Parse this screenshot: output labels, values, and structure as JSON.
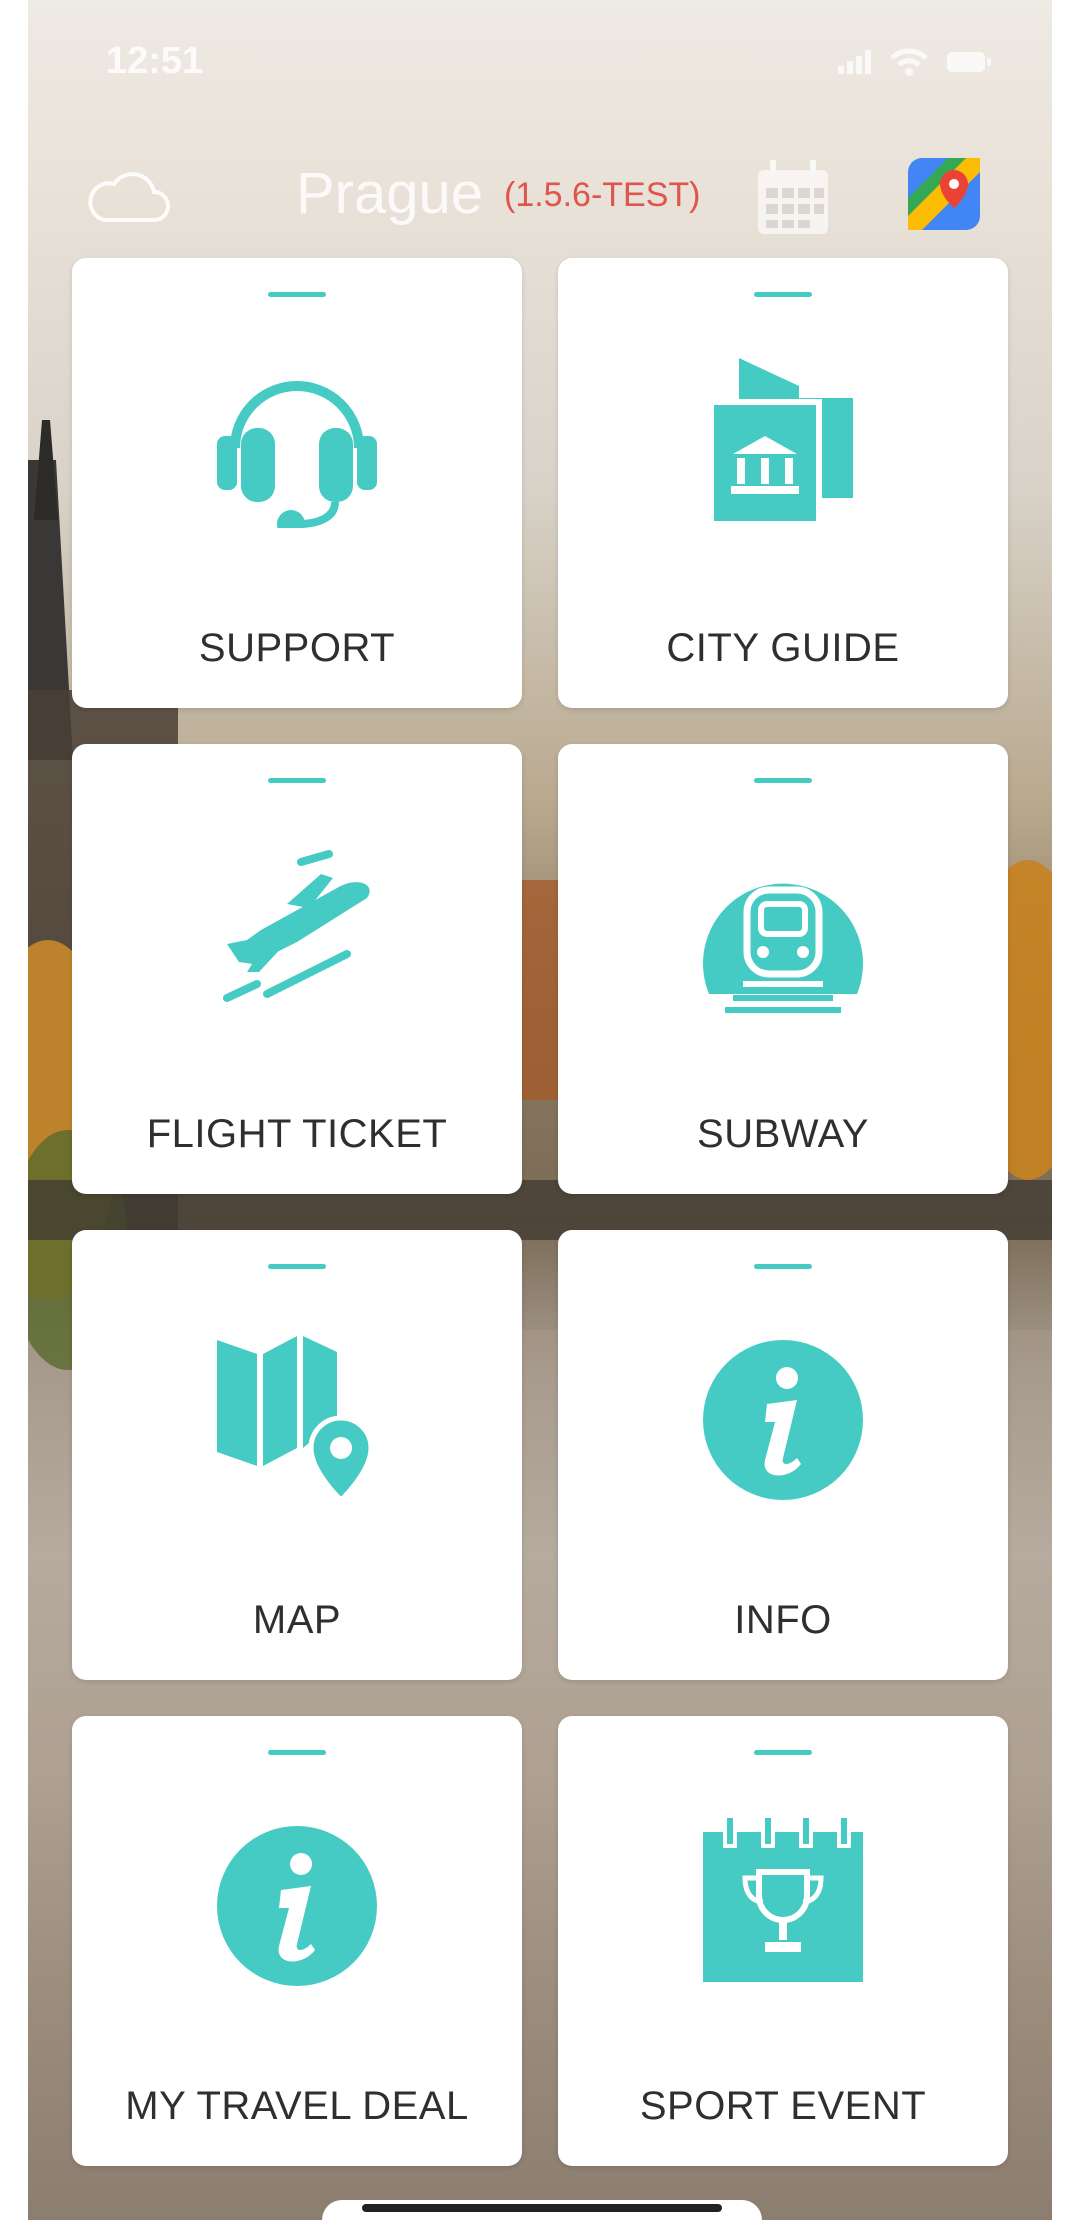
{
  "status_bar": {
    "time": "12:51"
  },
  "header": {
    "city": "Prague",
    "version": "(1.5.6-TEST)"
  },
  "tiles": [
    {
      "label": "SUPPORT",
      "icon": "headset-icon"
    },
    {
      "label": "CITY GUIDE",
      "icon": "city-guide-icon"
    },
    {
      "label": "FLIGHT TICKET",
      "icon": "airplane-icon"
    },
    {
      "label": "SUBWAY",
      "icon": "train-icon"
    },
    {
      "label": "MAP",
      "icon": "map-pin-icon"
    },
    {
      "label": "INFO",
      "icon": "info-icon"
    },
    {
      "label": "MY TRAVEL DEAL",
      "icon": "info-icon"
    },
    {
      "label": "SPORT EVENT",
      "icon": "trophy-calendar-icon"
    }
  ],
  "colors": {
    "accent": "#45cbc3",
    "version_text": "#e0544e",
    "tile_background": "#ffffff"
  }
}
